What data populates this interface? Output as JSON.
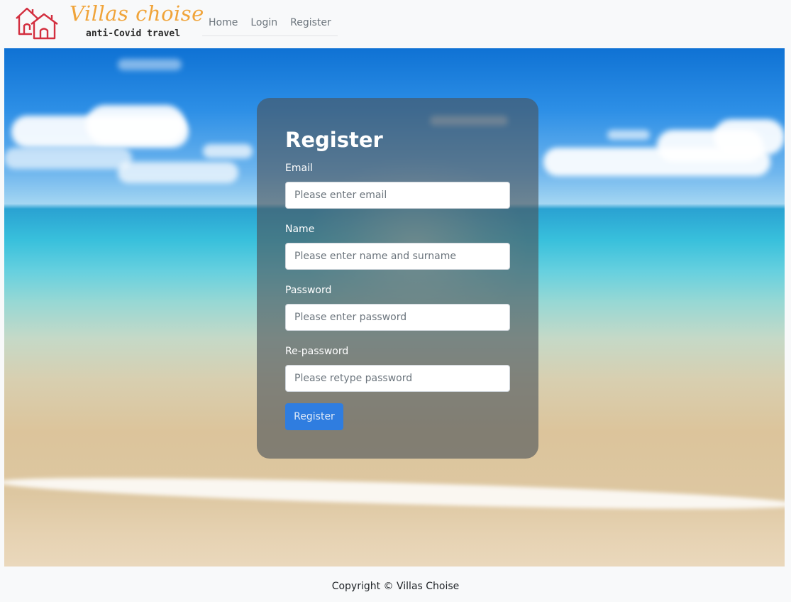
{
  "brand": {
    "name": "Villas choise",
    "tagline": "anti-Covid travel",
    "icon": "houses-icon",
    "colors": {
      "script": "#f0a43a",
      "houses": "#d32f3f"
    }
  },
  "nav": {
    "items": [
      {
        "label": "Home"
      },
      {
        "label": "Login"
      },
      {
        "label": "Register"
      }
    ]
  },
  "form": {
    "title": "Register",
    "fields": [
      {
        "label": "Email",
        "placeholder": "Please enter email",
        "type": "email",
        "value": ""
      },
      {
        "label": "Name",
        "placeholder": "Please enter name and surname",
        "type": "text",
        "value": ""
      },
      {
        "label": "Password",
        "placeholder": "Please enter password",
        "type": "password",
        "value": ""
      },
      {
        "label": "Re-password",
        "placeholder": "Please retype password",
        "type": "password",
        "value": ""
      }
    ],
    "submit_label": "Register",
    "submit_color": "#2f7de0"
  },
  "footer": {
    "copyright": "Copyright © Villas Choise"
  }
}
